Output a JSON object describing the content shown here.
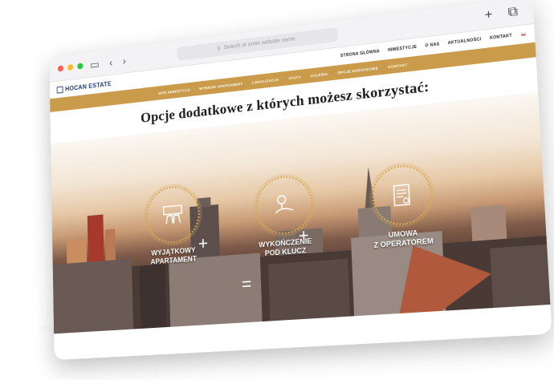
{
  "browser": {
    "address_placeholder": "Search or enter website name"
  },
  "site": {
    "logo_text": "HOCAN ESTATE",
    "top_nav": [
      "STRONA GŁÓWNA",
      "INWESTYCJE",
      "O NAS",
      "AKTUALNOŚCI",
      "KONTAKT"
    ],
    "main_nav": [
      "SPIS INWESTYCJI",
      "WYBIERZ APARTAMENT",
      "LOKALIZACJA",
      "ATUTY",
      "GALERIA",
      "OPCJE DODATKOWE",
      "KONTAKT"
    ],
    "heading": "Opcje dodatkowe z których możesz skorzystać:"
  },
  "options": [
    {
      "label_line1": "WYJĄTKOWY",
      "label_line2": "APARTAMENT",
      "icon": "room-icon"
    },
    {
      "label_line1": "WYKOŃCZENIE",
      "label_line2": "POD KLUCZ",
      "icon": "keys-hand-icon"
    },
    {
      "label_line1": "UMOWA",
      "label_line2": "Z OPERATOREM",
      "icon": "contract-icon"
    }
  ],
  "colors": {
    "gold": "#c99b4b",
    "brand_blue": "#1b3a78"
  }
}
